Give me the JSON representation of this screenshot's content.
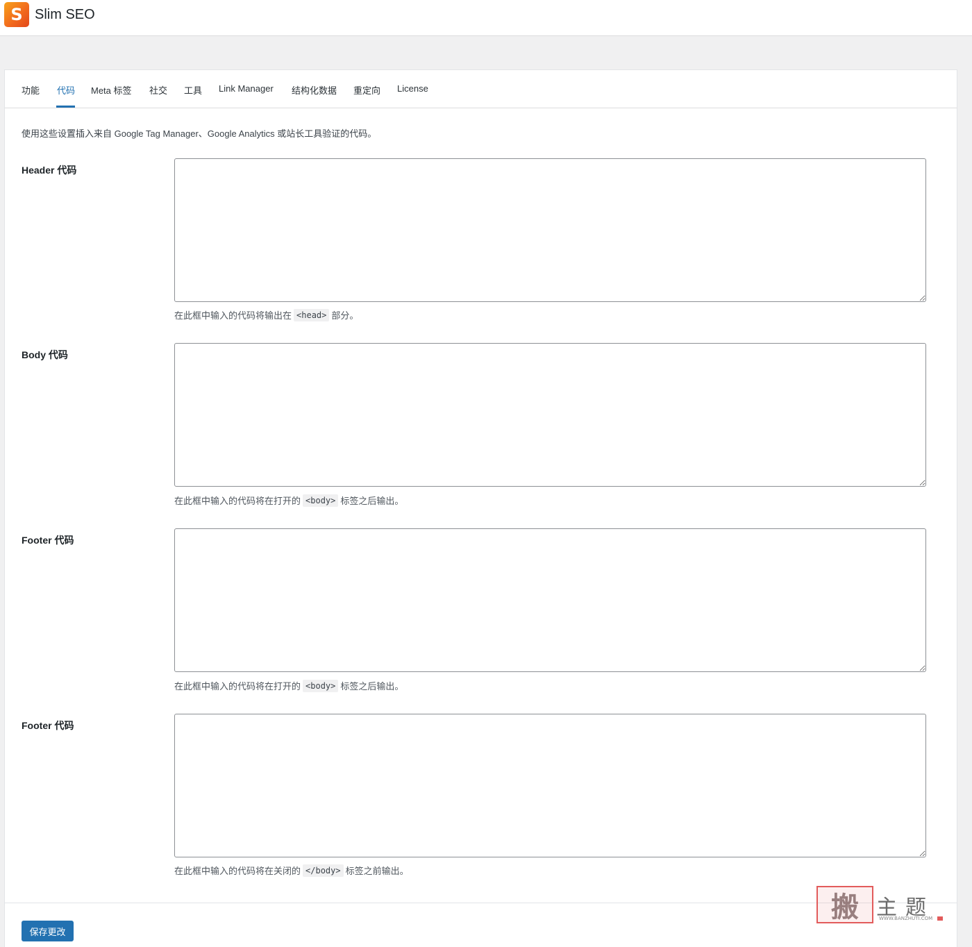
{
  "app": {
    "logo_letter": "S",
    "title": "Slim SEO"
  },
  "tabs": [
    {
      "label": "功能",
      "active": false
    },
    {
      "label": "代码",
      "active": true
    },
    {
      "label": "Meta 标签",
      "active": false
    },
    {
      "label": "社交",
      "active": false
    },
    {
      "label": "工具",
      "active": false
    },
    {
      "label": "Link Manager",
      "active": false
    },
    {
      "label": "结构化数据",
      "active": false
    },
    {
      "label": "重定向",
      "active": false
    },
    {
      "label": "License",
      "active": false
    }
  ],
  "intro": "使用这些设置插入来自 Google Tag Manager、Google Analytics 或站长工具验证的代码。",
  "fields": [
    {
      "label": "Header 代码",
      "value": "",
      "desc_before": "在此框中输入的代码将输出在",
      "desc_code": "<head>",
      "desc_after": "部分。"
    },
    {
      "label": "Body 代码",
      "value": "",
      "desc_before": "在此框中输入的代码将在打开的",
      "desc_code": "<body>",
      "desc_after": "标签之后输出。"
    },
    {
      "label": "Footer 代码",
      "value": "",
      "desc_before": "在此框中输入的代码将在打开的",
      "desc_code": "<body>",
      "desc_after": "标签之后输出。"
    },
    {
      "label": "Footer 代码",
      "value": "",
      "desc_before": "在此框中输入的代码将在关闭的",
      "desc_code": "</body>",
      "desc_after": "标签之前输出。"
    }
  ],
  "save_button": "保存更改",
  "watermark": {
    "seal_char": "搬",
    "text": "主题",
    "url": "WWW.BANZHUTI.COM"
  },
  "colors": {
    "accent": "#2271b1",
    "logo_gradient_start": "#f7a21b",
    "logo_gradient_end": "#e2471a"
  }
}
